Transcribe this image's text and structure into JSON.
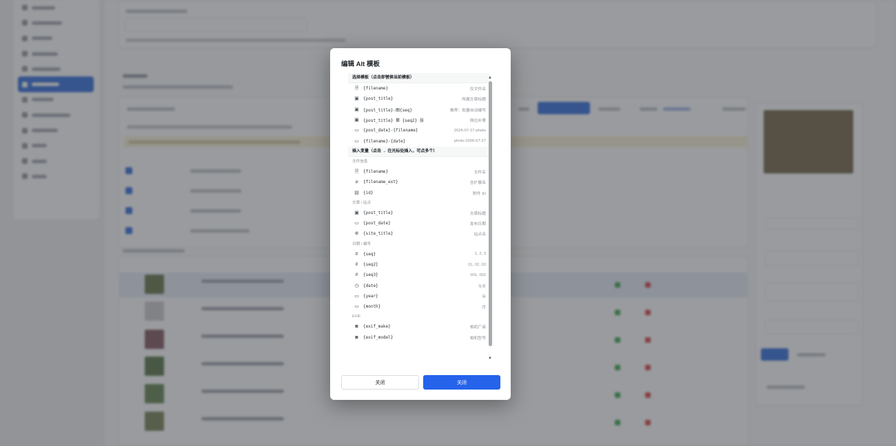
{
  "modal": {
    "title": "编辑 Alt 模板",
    "section_templates": "选择模板（点击即替换当前模板）",
    "templates": [
      {
        "icon": "document-icon",
        "token": "{filename}",
        "desc": "仅文件名"
      },
      {
        "icon": "image-icon",
        "token": "{post_title}",
        "desc": "所属文章标题"
      },
      {
        "icon": "image-icon",
        "token": "{post_title}-图{seq}",
        "desc": "推荐：批量自动编号"
      },
      {
        "icon": "image-icon",
        "token": "{post_title} 第 {seq2} 张",
        "desc": "两位补零"
      },
      {
        "icon": "calendar-icon",
        "token": "{post_date}-{filename}",
        "desc": "2026-07-27-photo"
      },
      {
        "icon": "calendar-icon",
        "token": "{filename}-{date}",
        "desc": "photo-2026-07-27"
      }
    ],
    "section_variables": "插入变量（点击 → 在光标处插入，可点多个）",
    "groups": [
      {
        "label": "文件信息",
        "items": [
          {
            "icon": "document-icon",
            "token": "{filename}",
            "desc": "文件名"
          },
          {
            "icon": "paperclip-icon",
            "token": "{filename_ext}",
            "desc": "含扩展名"
          },
          {
            "icon": "id-card-icon",
            "token": "{id}",
            "desc": "附件 ID"
          }
        ]
      },
      {
        "label": "文章 / 站点",
        "items": [
          {
            "icon": "image-icon",
            "token": "{post_title}",
            "desc": "文章标题"
          },
          {
            "icon": "calendar-icon",
            "token": "{post_date}",
            "desc": "发布日期"
          },
          {
            "icon": "globe-icon",
            "token": "{site_title}",
            "desc": "站点名"
          }
        ]
      },
      {
        "label": "日期 / 编号",
        "items": [
          {
            "icon": "hash-icon",
            "token": "{seq}",
            "desc": "1, 2, 3"
          },
          {
            "icon": "hash-icon",
            "token": "{seq2}",
            "desc": "01, 02, 03"
          },
          {
            "icon": "hash-icon",
            "token": "{seq3}",
            "desc": "001, 002"
          },
          {
            "icon": "clock-icon",
            "token": "{date}",
            "desc": "今天"
          },
          {
            "icon": "calendar-icon",
            "token": "{year}",
            "desc": "年"
          },
          {
            "icon": "calendar-icon",
            "token": "{month}",
            "desc": "月"
          }
        ]
      },
      {
        "label": "EXIF",
        "items": [
          {
            "icon": "camera-icon",
            "token": "{exif_make}",
            "desc": "相机厂商"
          },
          {
            "icon": "camera-icon",
            "token": "{exif_model}",
            "desc": "相机型号"
          }
        ]
      }
    ],
    "cancel_label": "关闭",
    "confirm_label": "关闭"
  },
  "icons": {
    "document-icon": "🗎",
    "image-icon": "▣",
    "calendar-icon": "▭",
    "paperclip-icon": "⌀",
    "id-card-icon": "▤",
    "globe-icon": "⊕",
    "hash-icon": "#",
    "clock-icon": "◷",
    "camera-icon": "◙"
  },
  "colors": {
    "primary": "#2563eb",
    "overlay": "#46484e",
    "sidebar_active": "#2563d9"
  }
}
